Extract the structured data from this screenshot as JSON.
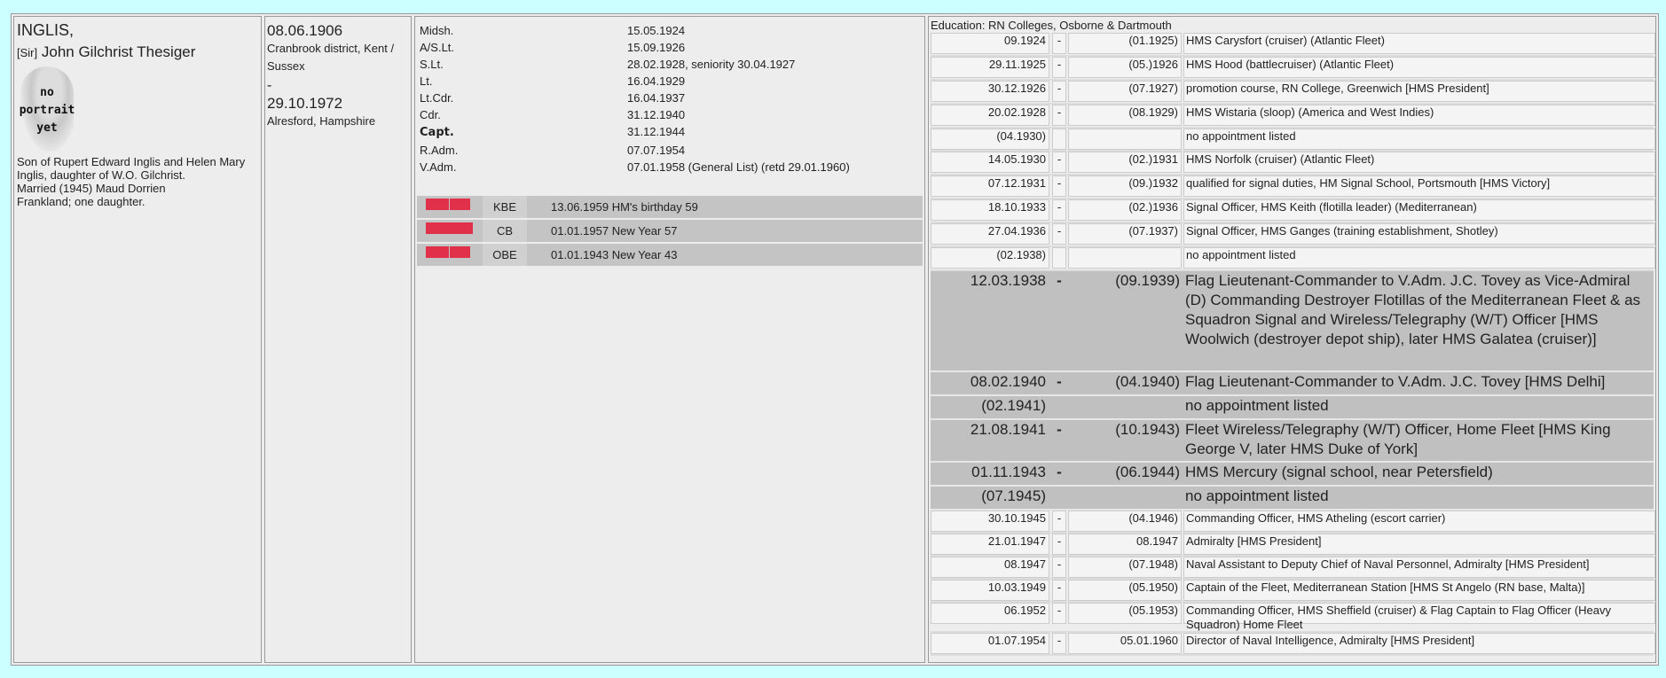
{
  "person": {
    "surname": "INGLIS,",
    "prefix": "[Sir]",
    "given_names": "John Gilchrist Thesiger",
    "portrait": [
      "no",
      "portrait",
      "yet"
    ],
    "bio": [
      "Son of Rupert Edward Inglis and Helen Mary",
      "Inglis, daughter of W.O. Gilchrist.",
      "Married (1945) Maud Dorrien",
      "Frankland; one daughter."
    ]
  },
  "life": {
    "birth_date": "08.06.1906",
    "birth_place": [
      "Cranbrook district, Kent /",
      "Sussex"
    ],
    "dash": "-",
    "death_date": "29.10.1972",
    "death_place": "Alresford, Hampshire"
  },
  "ranks": [
    {
      "rank": "Midsh.",
      "date": "15.05.1924"
    },
    {
      "rank": "A/S.Lt.",
      "date": "15.09.1926"
    },
    {
      "rank": "S.Lt.",
      "date": "28.02.1928, seniority 30.04.1927"
    },
    {
      "rank": "Lt.",
      "date": "16.04.1929"
    },
    {
      "rank": "Lt.Cdr.",
      "date": "16.04.1937"
    },
    {
      "rank": "Cdr.",
      "date": "31.12.1940"
    },
    {
      "rank": "Capt.",
      "date": "31.12.1944"
    },
    {
      "rank": "R.Adm.",
      "date": "07.07.1954"
    },
    {
      "rank": "V.Adm.",
      "date": "07.01.1958 (General List) (retd 29.01.1960)"
    }
  ],
  "awards": [
    {
      "abbr": "KBE",
      "date": "13.06.1959",
      "occasion": "HM's birthday 59"
    },
    {
      "abbr": "CB",
      "date": "01.01.1957",
      "occasion": "New Year 57"
    },
    {
      "abbr": "OBE",
      "date": "01.01.1943",
      "occasion": "New Year 43"
    }
  ],
  "ribbon_color": "#e0304a",
  "education": "Education: RN Colleges, Osborne & Dartmouth",
  "appointments": [
    {
      "from": "09.1924",
      "sep": "-",
      "to": "(01.1925)",
      "text": "HMS Carysfort (cruiser) (Atlantic Fleet)"
    },
    {
      "from": "29.11.1925",
      "sep": "-",
      "to": "(05.)1926",
      "text": "HMS Hood (battlecruiser) (Atlantic Fleet)"
    },
    {
      "from": "30.12.1926",
      "sep": "-",
      "to": "(07.1927)",
      "text": "promotion course, RN College, Greenwich [HMS President]"
    },
    {
      "from": "20.02.1928",
      "sep": "-",
      "to": "(08.1929)",
      "text": "HMS Wistaria (sloop) (America and West Indies)"
    },
    {
      "from": "(04.1930)",
      "sep": "",
      "to": "",
      "text": "no appointment listed"
    },
    {
      "from": "14.05.1930",
      "sep": "-",
      "to": "(02.)1931",
      "text": "HMS Norfolk (cruiser) (Atlantic Fleet)"
    },
    {
      "from": "07.12.1931",
      "sep": "-",
      "to": "(09.)1932",
      "text": "qualified for signal duties, HM Signal School, Portsmouth [HMS Victory]"
    },
    {
      "from": "18.10.1933",
      "sep": "-",
      "to": "(02.)1936",
      "text": "Signal Officer, HMS Keith (flotilla leader) (Mediterranean)"
    },
    {
      "from": "27.04.1936",
      "sep": "-",
      "to": "(07.1937)",
      "text": "Signal Officer, HMS Ganges (training establishment, Shotley)"
    },
    {
      "from": "(02.1938)",
      "sep": "",
      "to": "",
      "text": "no appointment listed"
    }
  ],
  "war_appointments": [
    {
      "from": "12.03.1938",
      "sep": "-",
      "to": "(09.1939)",
      "text": "Flag Lieutenant-Commander to V.Adm. J.C. Tovey as Vice-Admiral (D) Commanding Destroyer Flotillas of the Mediterranean Fleet & as Squadron Signal and Wireless/Telegraphy (W/T) Officer [HMS Woolwich (destroyer depot ship), later HMS Galatea (cruiser)]"
    },
    {
      "from": "08.02.1940",
      "sep": "-",
      "to": "(04.1940)",
      "text": "Flag Lieutenant-Commander to V.Adm. J.C. Tovey [HMS Delhi]"
    },
    {
      "from": "(02.1941)",
      "sep": "",
      "to": "",
      "text": "no appointment listed"
    },
    {
      "from": "21.08.1941",
      "sep": "-",
      "to": "(10.1943)",
      "text": "Fleet Wireless/Telegraphy (W/T) Officer, Home Fleet [HMS King George V, later HMS Duke of York]"
    },
    {
      "from": "01.11.1943",
      "sep": "-",
      "to": "(06.1944)",
      "text": "HMS Mercury (signal school, near Petersfield)"
    },
    {
      "from": "(07.1945)",
      "sep": "",
      "to": "",
      "text": "no appointment listed"
    }
  ],
  "post_appointments": [
    {
      "from": "30.10.1945",
      "sep": "-",
      "to": "(04.1946)",
      "text": "Commanding Officer, HMS Atheling (escort carrier)"
    },
    {
      "from": "21.01.1947",
      "sep": "-",
      "to": "08.1947",
      "text": "Admiralty [HMS President]"
    },
    {
      "from": "08.1947",
      "sep": "-",
      "to": "(07.1948)",
      "text": "Naval Assistant to Deputy Chief of Naval Personnel, Admiralty [HMS President]"
    },
    {
      "from": "10.03.1949",
      "sep": "-",
      "to": "(05.1950)",
      "text": "Captain of the Fleet, Mediterranean Station [HMS St Angelo (RN base, Malta)]"
    },
    {
      "from": "06.1952",
      "sep": "-",
      "to": "(05.1953)",
      "text": "Commanding Officer, HMS Sheffield (cruiser) & Flag Captain to Flag Officer (Heavy Squadron) Home Fleet"
    },
    {
      "from": "01.07.1954",
      "sep": "-",
      "to": "05.01.1960",
      "text": "Director of Naval Intelligence, Admiralty [HMS President]"
    }
  ]
}
